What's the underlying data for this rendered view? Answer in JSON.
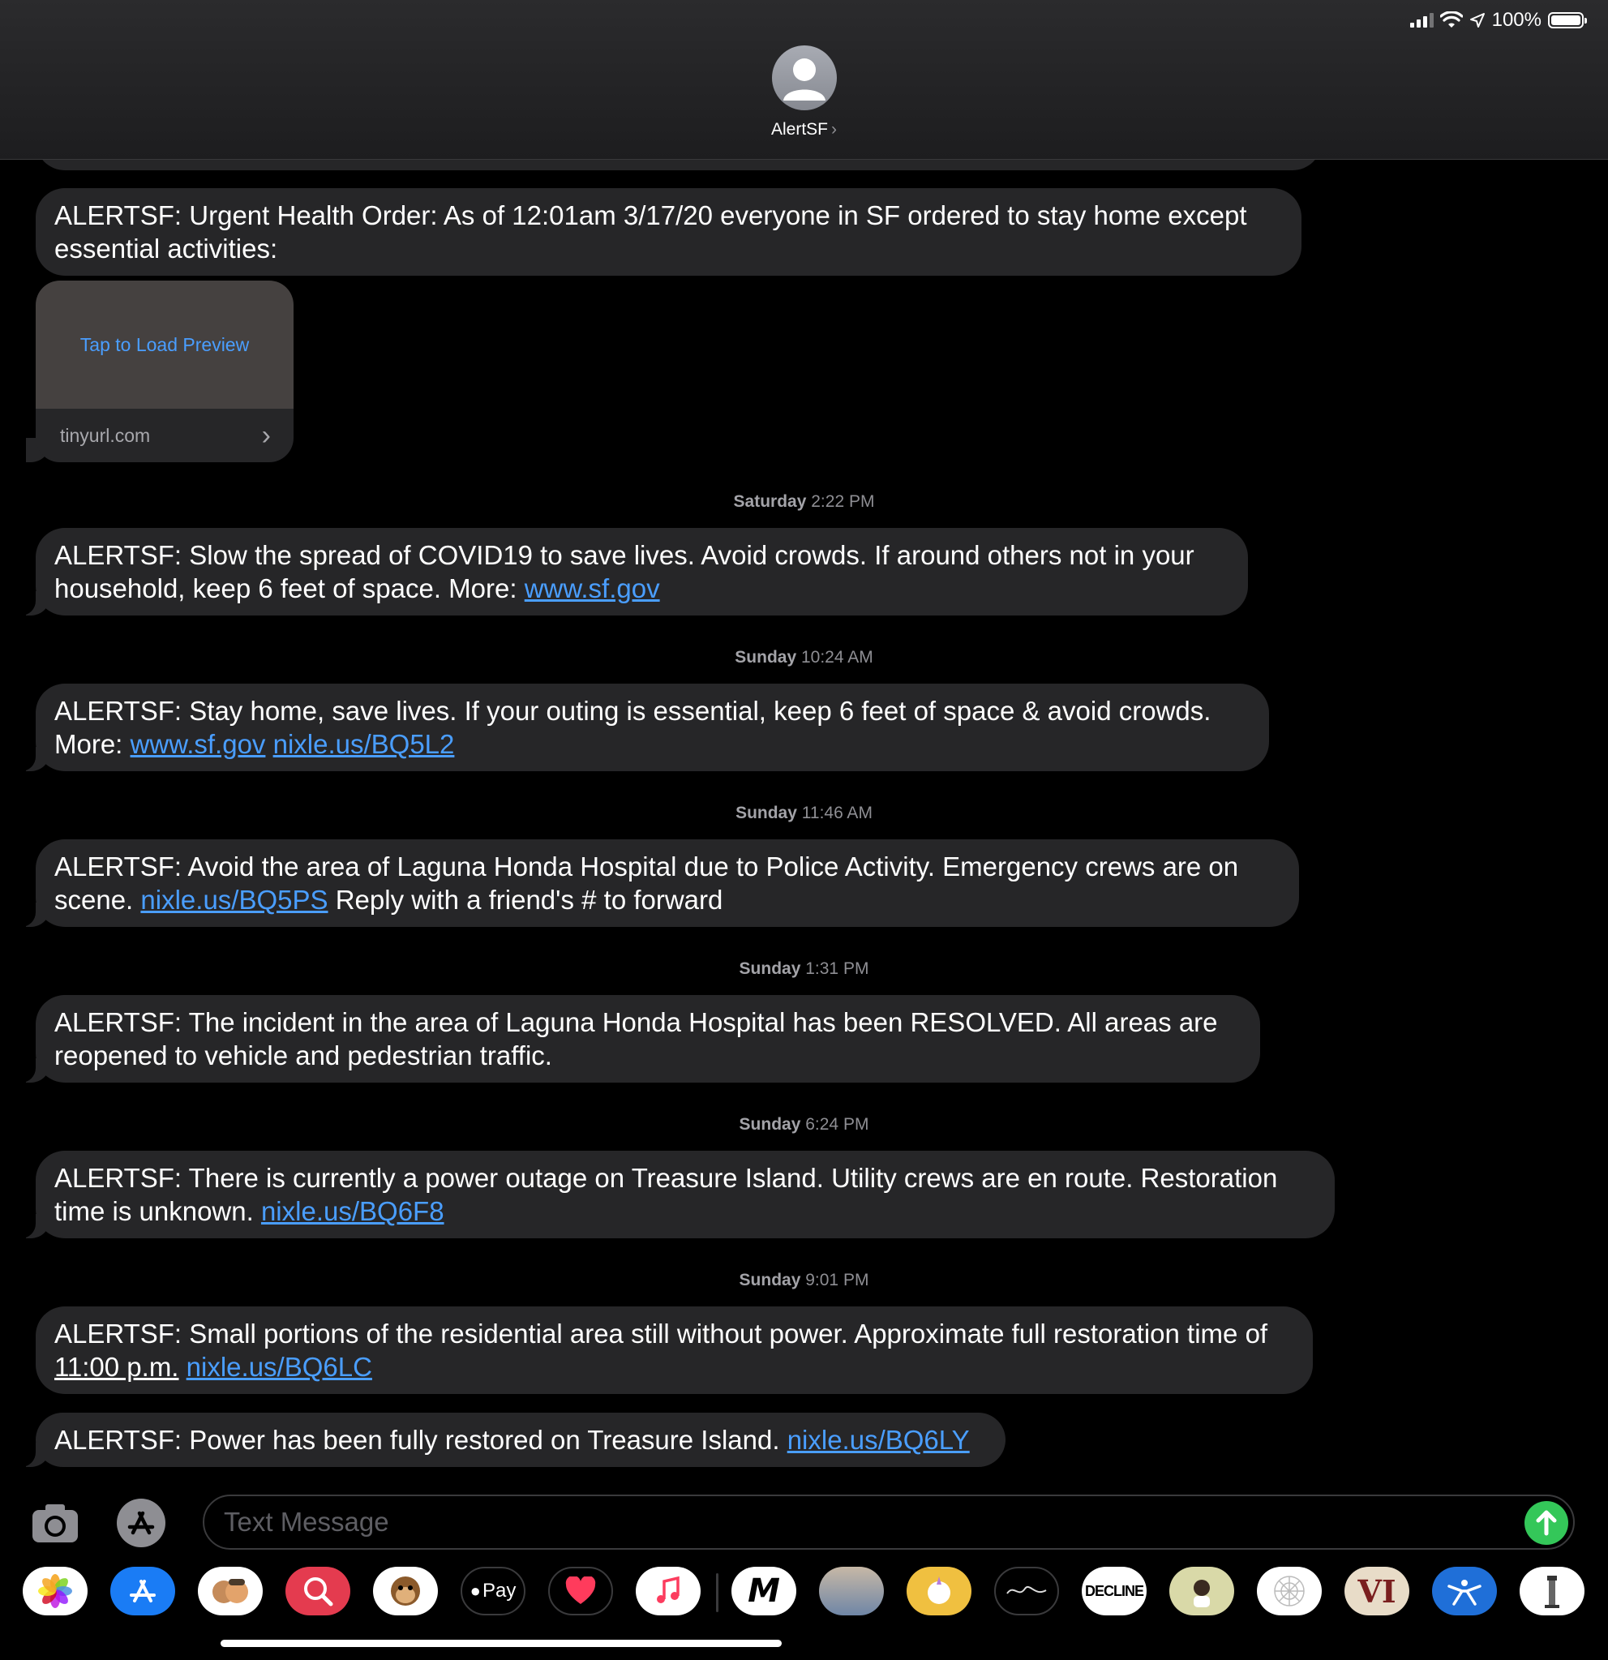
{
  "status": {
    "battery": "100%",
    "battery_level": 1.0,
    "signal_bars": 3
  },
  "contact": {
    "name": "AlertSF",
    "chevron": "›"
  },
  "preview_card": {
    "tap_label": "Tap to Load Preview",
    "domain": "tinyurl.com",
    "arrow": "›"
  },
  "messages": [
    {
      "text": "ALERTSF: Urgent Health Order: As of 12:01am 3/17/20 everyone in SF ordered to stay home except essential activities:"
    },
    {
      "text": "ALERTSF: Slow the spread of COVID19 to save lives. Avoid crowds. If around others not in your household, keep 6 feet of space. More: ",
      "links": [
        "www.sf.gov"
      ]
    },
    {
      "text": "ALERTSF: Stay home, save lives. If your outing is essential, keep 6 feet of space & avoid crowds. More: ",
      "links": [
        "www.sf.gov",
        "nixle.us/BQ5L2"
      ]
    },
    {
      "text1": "ALERTSF: Avoid the area of Laguna Honda Hospital due to Police Activity. Emergency crews are on scene. ",
      "link": "nixle.us/BQ5PS",
      "text2": " Reply with a friend's # to forward"
    },
    {
      "text": "ALERTSF: The incident in the area of Laguna Honda Hospital has been RESOLVED. All areas are reopened to vehicle and pedestrian traffic."
    },
    {
      "text": "ALERTSF: There is currently a power outage on Treasure Island. Utility crews are en route. Restoration time is unknown. ",
      "links": [
        "nixle.us/BQ6F8"
      ]
    },
    {
      "text": "ALERTSF: Small portions of the residential area still without power. Approximate full restoration time of ",
      "time_link": "11:00 p.m.",
      "links": [
        "nixle.us/BQ6LC"
      ]
    },
    {
      "text": "ALERTSF: Power has been fully restored on Treasure Island. ",
      "links": [
        "nixle.us/BQ6LY"
      ]
    }
  ],
  "timestamps": [
    {
      "day": "Saturday",
      "time": "2:22 PM"
    },
    {
      "day": "Sunday",
      "time": "10:24 AM"
    },
    {
      "day": "Sunday",
      "time": "11:46 AM"
    },
    {
      "day": "Sunday",
      "time": "1:31 PM"
    },
    {
      "day": "Sunday",
      "time": "6:24 PM"
    },
    {
      "day": "Sunday",
      "time": "9:01 PM"
    }
  ],
  "composer": {
    "placeholder": "Text Message"
  },
  "app_drawer": [
    {
      "name": "photos-icon"
    },
    {
      "name": "app-store-icon"
    },
    {
      "name": "memoji-icon"
    },
    {
      "name": "web-search-icon"
    },
    {
      "name": "animoji-monkey-icon"
    },
    {
      "name": "apple-pay-icon",
      "label": "Pay"
    },
    {
      "name": "digital-touch-icon"
    },
    {
      "name": "music-icon"
    },
    {
      "name": "m-app-icon",
      "label": "M"
    },
    {
      "name": "horizon-icon"
    },
    {
      "name": "unicorn-sticker-icon"
    },
    {
      "name": "dickinson-icon"
    },
    {
      "name": "decline-icon",
      "label": "DECLINE"
    },
    {
      "name": "yaaas-sticker-icon"
    },
    {
      "name": "grid-app-icon"
    },
    {
      "name": "vi-app-icon",
      "label": "VI"
    },
    {
      "name": "fitness-app-icon"
    },
    {
      "name": "lighthouse-app-icon"
    }
  ],
  "colors": {
    "link": "#4a9eff",
    "bubble": "#262628",
    "send": "#34c759",
    "background": "#000000"
  }
}
